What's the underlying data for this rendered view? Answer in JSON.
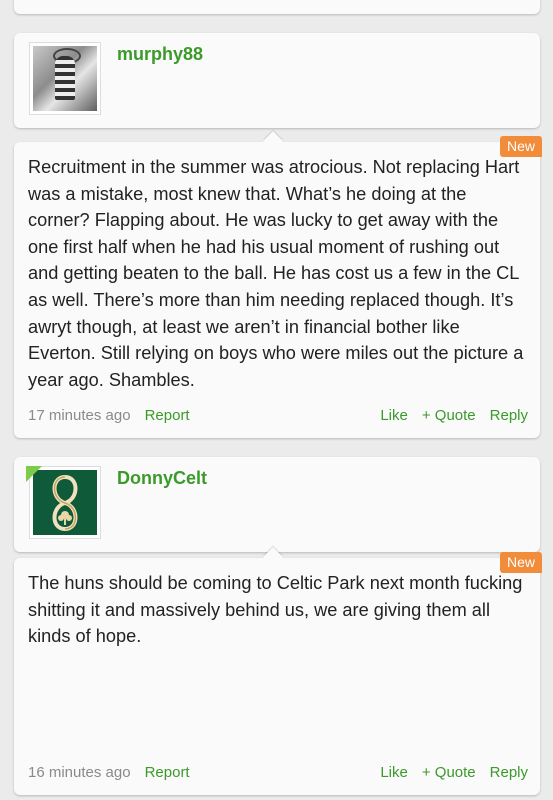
{
  "posts": [
    {
      "username": "murphy88",
      "avatar_icon": "trophy-celebration-photo",
      "badge": "New",
      "body": "Recruitment in the summer was atrocious. Not replacing Hart was a mistake, most knew that. What’s he doing at the corner? Flapping about. He was lucky to get away with the one first half when he had his usual moment of rushing out and getting beaten to the ball. He has cost us a few in the CL as well. There’s more than him needing replaced though. It’s awryt though, at least we aren’t in financial bother like Everton. Still relying on boys who were miles out the picture a year ago. Shambles.",
      "time": "17 minutes ago",
      "report_label": "Report",
      "like_label": "Like",
      "quote_label": "+ Quote",
      "reply_label": "Reply"
    },
    {
      "username": "DonnyCelt",
      "avatar_icon": "celtic-crest-icon",
      "badge": "New",
      "body": "The huns should be coming to Celtic Park next month fucking shitting it and massively behind us, we are giving them all kinds of hope.",
      "time": "16 minutes ago",
      "report_label": "Report",
      "like_label": "Like",
      "quote_label": "+ Quote",
      "reply_label": "Reply"
    }
  ],
  "colors": {
    "accent_green": "#3b9a2a",
    "new_badge": "#f08c3a",
    "background": "#ebebeb",
    "card": "#fafafa",
    "timestamp": "#8a8a8a"
  }
}
